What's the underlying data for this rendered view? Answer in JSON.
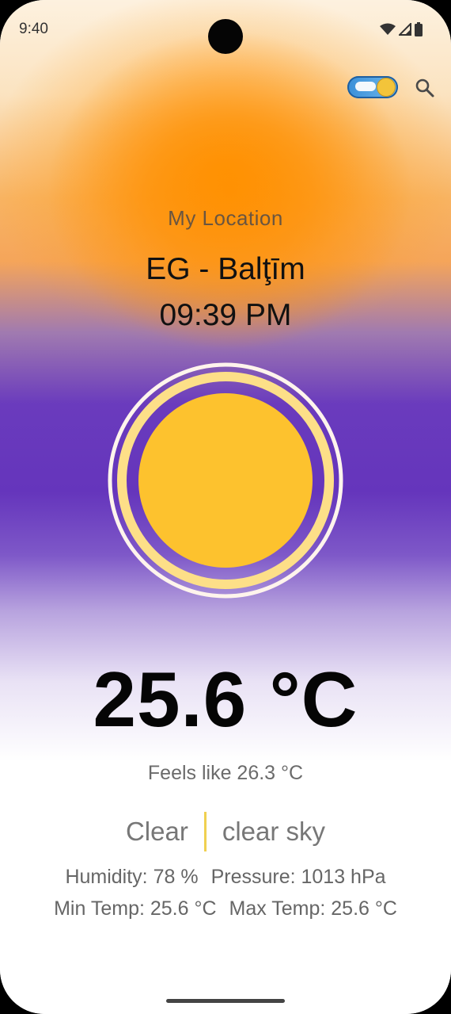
{
  "status_bar": {
    "time": "9:40",
    "icons": [
      "wifi-icon",
      "cellular-icon",
      "battery-icon"
    ]
  },
  "top_bar": {
    "theme_toggle_icon": "day-night-toggle-icon",
    "search_icon": "search-icon"
  },
  "location": {
    "label": "My Location",
    "city": "EG - Balţīm",
    "time": "09:39 PM"
  },
  "weather": {
    "icon": "sun-icon",
    "temperature": "25.6 °C",
    "feels_like": "Feels like 26.3 °C",
    "main": "Clear",
    "description": "clear sky",
    "humidity": "Humidity: 78 %",
    "pressure": "Pressure: 1013 hPa",
    "min_temp": "Min Temp: 25.6 °C",
    "max_temp": "Max Temp: 25.6 °C"
  },
  "colors": {
    "sun": "#FDC22E",
    "accent_orange": "#FF8C00",
    "accent_purple": "#6535BC",
    "divider": "#F0D050"
  }
}
